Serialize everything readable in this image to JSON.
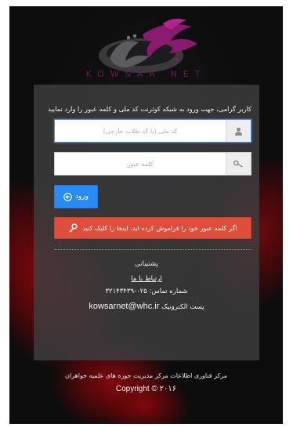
{
  "brand": {
    "logo_text_fa": "کوثرنت",
    "logo_text_en": "KOWSAR NET",
    "colors": {
      "accent": "#8a1a6e",
      "logo_dark": "#5a5a5a"
    }
  },
  "login": {
    "intro": "کاربر گرامی، جهت ورود به شبکه کوثرنت کد ملی و کلمه عبور را وارد نمایید",
    "username_placeholder": "کد ملی (یا کد طلاب خارجی)",
    "username_value": "",
    "username_icon": "user-icon",
    "password_placeholder": "کلمه عبور",
    "password_value": "",
    "password_icon": "key-icon",
    "login_label": "ورود",
    "login_icon": "arrow-circle-left-icon",
    "login_color": "#2a8bf2",
    "forgot_label": "اگر کلمه عبور خود را فراموش کرده اید، اینجا را کلیک کنید",
    "forgot_icon": "key-icon",
    "forgot_color": "#df4e3a"
  },
  "support": {
    "title": "پشتیبانی",
    "contact_link": "ارتباط با ما",
    "phone": "شماره تماس: ۰۲۵-۳۲۱۴۳۴۳۹",
    "email_label": "پست الکترونیک",
    "email": "kowsarnet@whc.ir"
  },
  "footer": {
    "org": "مرکز فناوری اطلاعات مرکز مدیریت حوزه های علمیه خواهران",
    "copyright": "Copyright © ۲۰۱۶"
  }
}
